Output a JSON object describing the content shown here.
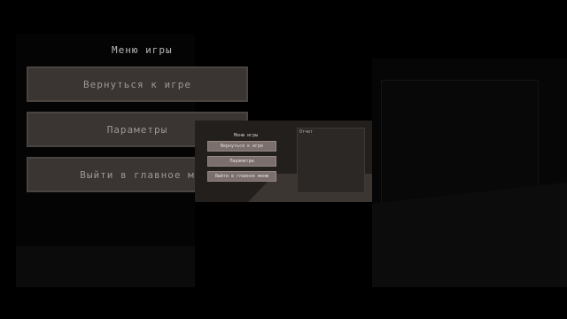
{
  "left_menu": {
    "title": "Меню игры",
    "buttons": [
      {
        "label": "Вернуться к игре"
      },
      {
        "label": "Параметры"
      },
      {
        "label": "Выйти в главное м"
      }
    ]
  },
  "center_menu": {
    "title": "Меню игры",
    "buttons": [
      {
        "label": "Вернуться к игре"
      },
      {
        "label": "Параметры"
      },
      {
        "label": "Выйти в главное меню"
      }
    ],
    "info_label": "Отчет"
  },
  "colors": {
    "background": "#000000",
    "button_bg": "#7a6f6c",
    "button_text": "#e4dedb"
  }
}
